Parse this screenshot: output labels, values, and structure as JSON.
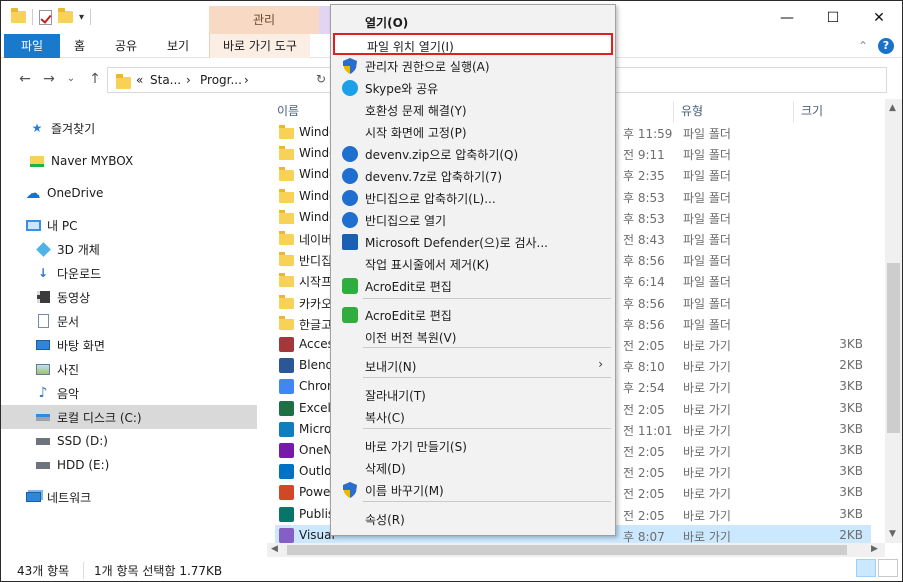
{
  "window": {
    "context_tab_label": "관리",
    "controls": {
      "minimize": "—",
      "maximize": "☐",
      "close": "✕"
    }
  },
  "ribbon": {
    "tabs": [
      {
        "label": "파일"
      },
      {
        "label": "홈"
      },
      {
        "label": "공유"
      },
      {
        "label": "보기"
      },
      {
        "label": "바로 가기 도구"
      }
    ],
    "help": "?",
    "collapse": "⌃"
  },
  "address": {
    "crumbs": [
      "«",
      "Sta...",
      "›",
      "Progr...",
      "›"
    ]
  },
  "nav": {
    "back": "←",
    "forward": "→",
    "recent": "⌄",
    "up": "↑",
    "items": [
      {
        "label": "즐겨찾기",
        "icon": "star-icon"
      },
      {
        "label": "Naver MYBOX",
        "icon": "cloud-folder-icon"
      },
      {
        "label": "OneDrive",
        "icon": "onedrive-cloud-icon"
      },
      {
        "label": "내 PC",
        "icon": "computer-icon"
      },
      {
        "label": "3D 개체",
        "icon": "3d-objects-icon"
      },
      {
        "label": "다운로드",
        "icon": "download-icon"
      },
      {
        "label": "동영상",
        "icon": "video-icon"
      },
      {
        "label": "문서",
        "icon": "document-icon"
      },
      {
        "label": "바탕 화면",
        "icon": "desktop-icon"
      },
      {
        "label": "사진",
        "icon": "pictures-icon"
      },
      {
        "label": "음악",
        "icon": "music-icon"
      },
      {
        "label": "로컬 디스크 (C:)",
        "icon": "local-disk-icon"
      },
      {
        "label": "SSD (D:)",
        "icon": "drive-icon"
      },
      {
        "label": "HDD (E:)",
        "icon": "drive-icon"
      },
      {
        "label": "네트워크",
        "icon": "network-icon"
      }
    ]
  },
  "filelist": {
    "columns": {
      "name": "이름",
      "type": "유형",
      "size": "크기"
    },
    "rows": [
      {
        "name": "Windo",
        "date": "후 11:59",
        "type": "파일 폴더",
        "size": "",
        "kind": "folder"
      },
      {
        "name": "Windo",
        "date": "전 9:11",
        "type": "파일 폴더",
        "size": "",
        "kind": "folder"
      },
      {
        "name": "Windo",
        "date": "후 2:35",
        "type": "파일 폴더",
        "size": "",
        "kind": "folder"
      },
      {
        "name": "Windo",
        "date": "후 8:53",
        "type": "파일 폴더",
        "size": "",
        "kind": "folder"
      },
      {
        "name": "Windo",
        "date": "후 8:53",
        "type": "파일 폴더",
        "size": "",
        "kind": "folder"
      },
      {
        "name": "네이버",
        "date": "전 8:43",
        "type": "파일 폴더",
        "size": "",
        "kind": "folder"
      },
      {
        "name": "반디집",
        "date": "후 8:56",
        "type": "파일 폴더",
        "size": "",
        "kind": "folder"
      },
      {
        "name": "시작프",
        "date": "후 6:14",
        "type": "파일 폴더",
        "size": "",
        "kind": "folder"
      },
      {
        "name": "카카오",
        "date": "후 8:56",
        "type": "파일 폴더",
        "size": "",
        "kind": "folder"
      },
      {
        "name": "한글고",
        "date": "후 8:56",
        "type": "파일 폴더",
        "size": "",
        "kind": "folder"
      },
      {
        "name": "Acces",
        "date": "전 2:05",
        "type": "바로 가기",
        "size": "3KB",
        "kind": "access"
      },
      {
        "name": "Blend",
        "date": "후 8:10",
        "type": "바로 가기",
        "size": "2KB",
        "kind": "blend"
      },
      {
        "name": "Chron",
        "date": "후 2:54",
        "type": "바로 가기",
        "size": "3KB",
        "kind": "chrome"
      },
      {
        "name": "Excel",
        "date": "전 2:05",
        "type": "바로 가기",
        "size": "3KB",
        "kind": "excel"
      },
      {
        "name": "Micro",
        "date": "전 11:01",
        "type": "바로 가기",
        "size": "3KB",
        "kind": "edge"
      },
      {
        "name": "OneN",
        "date": "전 2:05",
        "type": "바로 가기",
        "size": "3KB",
        "kind": "onenote"
      },
      {
        "name": "Outlo",
        "date": "전 2:05",
        "type": "바로 가기",
        "size": "3KB",
        "kind": "outlook"
      },
      {
        "name": "Powe",
        "date": "전 2:05",
        "type": "바로 가기",
        "size": "3KB",
        "kind": "powerpoint"
      },
      {
        "name": "Publis",
        "date": "전 2:05",
        "type": "바로 가기",
        "size": "3KB",
        "kind": "publisher"
      },
      {
        "name": "Visual",
        "date": "후 8:07",
        "type": "바로 가기",
        "size": "2KB",
        "kind": "vs",
        "selected": true
      }
    ]
  },
  "status": {
    "count": "43개 항목",
    "selection": "1개 항목 선택함 1.77KB"
  },
  "context_menu": {
    "items": [
      {
        "label": "열기(O)",
        "icon": "",
        "bold": true
      },
      {
        "label": "파일 위치 열기(I)",
        "icon": "",
        "highlight": true
      },
      {
        "label": "관리자 권한으로 실행(A)",
        "icon": "uac-shield-icon"
      },
      {
        "label": "Skype와 공유",
        "icon": "skype-icon"
      },
      {
        "label": "호환성 문제 해결(Y)",
        "icon": ""
      },
      {
        "label": "시작 화면에 고정(P)",
        "icon": ""
      },
      {
        "label": "devenv.zip으로 압축하기(Q)",
        "icon": "bandizip-icon"
      },
      {
        "label": "devenv.7z로 압축하기(7)",
        "icon": "bandizip-icon"
      },
      {
        "label": "반디집으로 압축하기(L)...",
        "icon": "bandizip-icon"
      },
      {
        "label": "반디집으로 열기",
        "icon": "bandizip-icon"
      },
      {
        "label": "Microsoft Defender(으)로 검사...",
        "icon": "defender-icon"
      },
      {
        "label": "작업 표시줄에서 제거(K)",
        "icon": ""
      },
      {
        "label": "AcroEdit로 편집",
        "icon": "acroedit-icon"
      },
      {
        "label": "AcroEdit로 편집",
        "icon": "acroedit-icon"
      },
      {
        "label": "이전 버전 복원(V)",
        "icon": ""
      },
      {
        "label": "보내기(N)",
        "icon": "",
        "submenu": "›"
      },
      {
        "label": "잘라내기(T)",
        "icon": ""
      },
      {
        "label": "복사(C)",
        "icon": ""
      },
      {
        "label": "바로 가기 만들기(S)",
        "icon": ""
      },
      {
        "label": "삭제(D)",
        "icon": ""
      },
      {
        "label": "이름 바꾸기(M)",
        "icon": "uac-shield-icon"
      },
      {
        "label": "속성(R)",
        "icon": ""
      }
    ]
  }
}
